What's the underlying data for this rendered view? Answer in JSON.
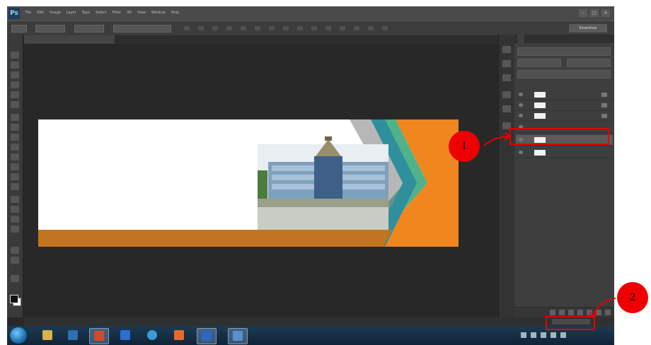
{
  "menubar": {
    "logo": "Ps",
    "items": [
      "File",
      "Edit",
      "Image",
      "Layer",
      "Type",
      "Select",
      "Filter",
      "3D",
      "View",
      "Window",
      "Help"
    ],
    "window_controls": [
      "–",
      "□",
      "✕"
    ]
  },
  "options_bar": {
    "essentials": "Essentials"
  },
  "document_tabs": [
    {
      "label": "",
      "active": true
    },
    {
      "label": "",
      "active": false
    }
  ],
  "layers_panel": {
    "tabs": [
      "",
      "",
      ""
    ],
    "layers": [
      {
        "name": "",
        "selected": false
      },
      {
        "name": "",
        "selected": false
      },
      {
        "name": "",
        "selected": false
      },
      {
        "name": "",
        "selected": false
      },
      {
        "name": "",
        "selected": true
      },
      {
        "name": "",
        "selected": false
      }
    ]
  },
  "status": {
    "doc_info": "",
    "minibridge_button": ""
  },
  "taskbar": {
    "apps": [
      "explorer-icon",
      "media-icon",
      "photoshop-icon",
      "mail-icon",
      "chrome-icon",
      "powerpoint-icon",
      "word-icon",
      "window-icon"
    ],
    "clock_time": "",
    "clock_date": ""
  },
  "annotations": {
    "callout_1": "1",
    "callout_2": "2",
    "color": "#e60000"
  },
  "colors": {
    "orange": "#f0861e",
    "brown_band": "#c2741e",
    "green_stripe": "#4fb28a",
    "teal_stripe": "#2f8f9d"
  }
}
